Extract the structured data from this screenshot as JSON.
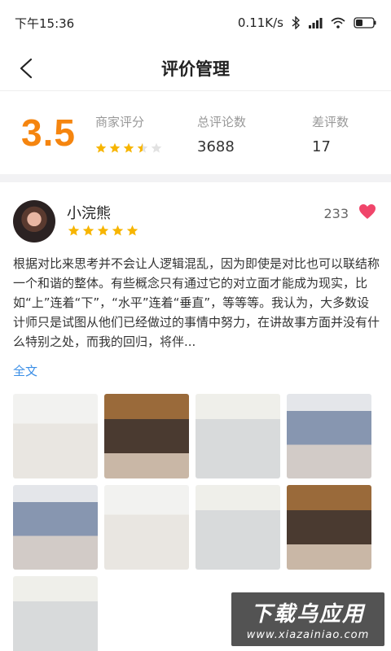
{
  "status_bar": {
    "time": "下午15:36",
    "network_speed": "0.11K/s",
    "icons": [
      "bluetooth-icon",
      "signal-icon",
      "wifi-icon",
      "battery-icon"
    ]
  },
  "nav": {
    "back_icon": "chevron-left-icon",
    "title": "评价管理"
  },
  "stats": {
    "score": "3.5",
    "merchant_rating_label": "商家评分",
    "merchant_rating_stars": 3.5,
    "total_reviews_label": "总评论数",
    "total_reviews_value": "3688",
    "bad_reviews_label": "差评数",
    "bad_reviews_value": "17"
  },
  "review": {
    "username": "小浣熊",
    "stars": 5,
    "likes": "233",
    "text": "根据对比来思考并不会让人逻辑混乱，因为即使是对比也可以联结称一个和谐的整体。有些概念只有通过它的对立面才能成为现实，比如“上”连着“下”，“水平”连着“垂直”，等等等。我认为，大多数设计师只是试图从他们已经做过的事情中努力，在讲故事方面并没有什么特别之处，而我的回归，将伴...",
    "full_text_link": "全文",
    "photo_count": 9
  },
  "watermark": {
    "title": "下载乌应用",
    "url": "www.xiazainiao.com"
  },
  "colors": {
    "accent": "#f5850f",
    "star": "#f7b500",
    "heart": "#f0456a",
    "link": "#3a8ee6"
  }
}
